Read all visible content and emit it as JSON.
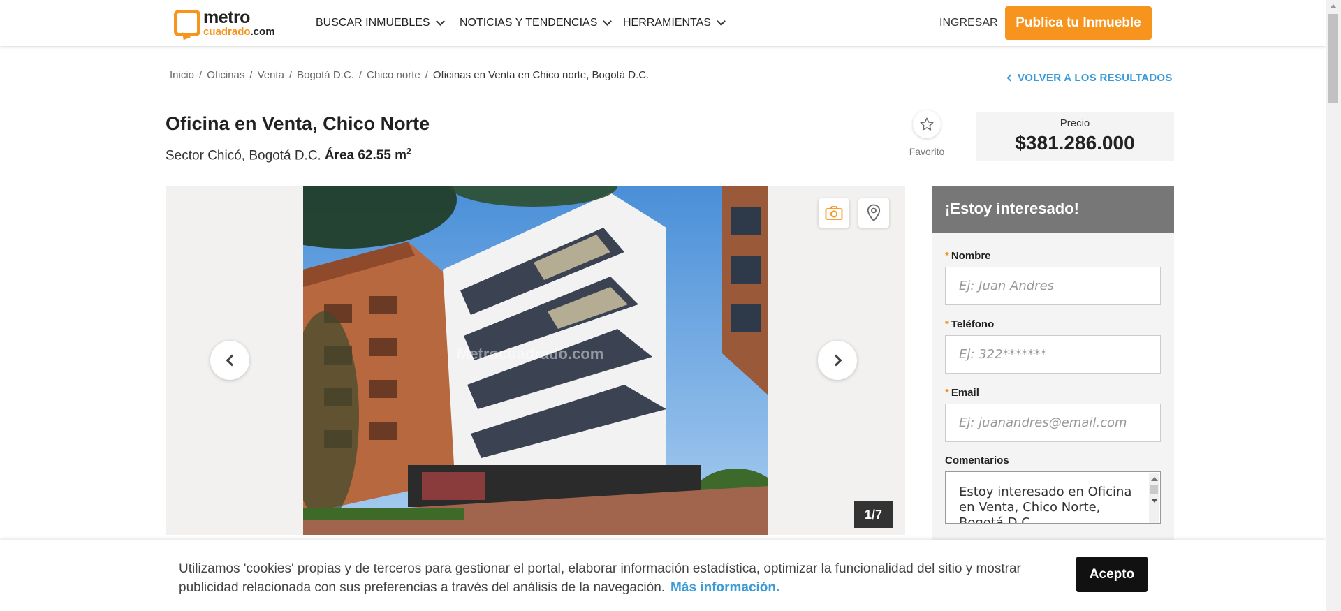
{
  "header": {
    "logo_top": "metro",
    "logo_bottom": "cuadrado",
    "logo_tld": ".com",
    "nav": [
      {
        "label": "BUSCAR INMUEBLES"
      },
      {
        "label": "NOTICIAS Y TENDENCIAS"
      },
      {
        "label": "HERRAMIENTAS"
      }
    ],
    "login_label": "INGRESAR",
    "publish_label": "Publica tu Inmueble"
  },
  "breadcrumb": {
    "items": [
      "Inicio",
      "Oficinas",
      "Venta",
      "Bogotá D.C.",
      "Chico norte"
    ],
    "current": "Oficinas en Venta en Chico norte, Bogotá D.C.",
    "back_label": "VOLVER A LOS RESULTADOS"
  },
  "listing": {
    "title": "Oficina en Venta, Chico Norte",
    "location": "Sector Chicó, Bogotá D.C.",
    "area_label": "Área 62.55 m",
    "area_sup": "2",
    "favorite_label": "Favorito",
    "price_label": "Precio",
    "price_value": "$381.286.000"
  },
  "gallery": {
    "watermark": "Metrocuadrado.com",
    "counter": "1/7"
  },
  "form": {
    "heading": "¡Estoy interesado!",
    "fields": [
      {
        "label": "Nombre",
        "placeholder": "Ej: Juan Andres"
      },
      {
        "label": "Teléfono",
        "placeholder": "Ej: 322*******"
      },
      {
        "label": "Email",
        "placeholder": "Ej: juanandres@email.com"
      }
    ],
    "comments_label": "Comentarios",
    "comments_value": "Estoy interesado en Oficina en Venta, Chico Norte, Bogotá D.C."
  },
  "cookie": {
    "text": "Utilizamos 'cookies' propias y de terceros para gestionar el portal, elaborar información estadística, optimizar la funcionalidad del sitio y mostrar publicidad relacionada con sus preferencias a través del análisis de la navegación.",
    "link": "Más información.",
    "accept_label": "Acepto"
  },
  "colors": {
    "brand_orange": "#f7941d",
    "link_blue": "#3a9bd6",
    "form_header": "#777777"
  }
}
